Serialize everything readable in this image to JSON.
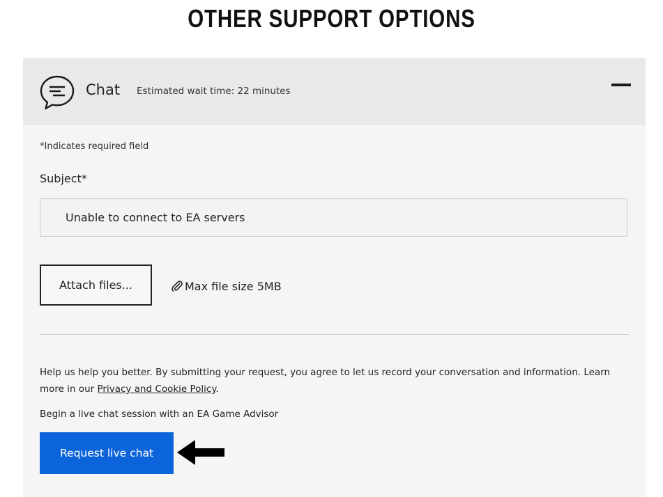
{
  "page_title": "OTHER SUPPORT OPTIONS",
  "chat_panel": {
    "title": "Chat",
    "wait_time": "Estimated wait time: 22 minutes",
    "icon": "chat-bubble-icon",
    "collapse_icon": "minus-icon"
  },
  "form": {
    "required_note": "*Indicates required field",
    "subject_label": "Subject*",
    "subject_value": "Unable to connect to EA servers",
    "attach_label": "Attach files...",
    "max_size_label": "Max file size 5MB",
    "paperclip_icon": "paperclip-icon"
  },
  "consent": {
    "text_before_link": "Help us help you better. By submitting your request, you agree to let us record your conversation and information. Learn more in our ",
    "link_text": "Privacy and Cookie Policy",
    "text_after_link": "."
  },
  "live_chat": {
    "prompt": "Begin a live chat session with an EA Game Advisor",
    "button_label": "Request live chat",
    "button_color": "#0b64d9",
    "arrow_icon": "left-arrow-icon"
  }
}
